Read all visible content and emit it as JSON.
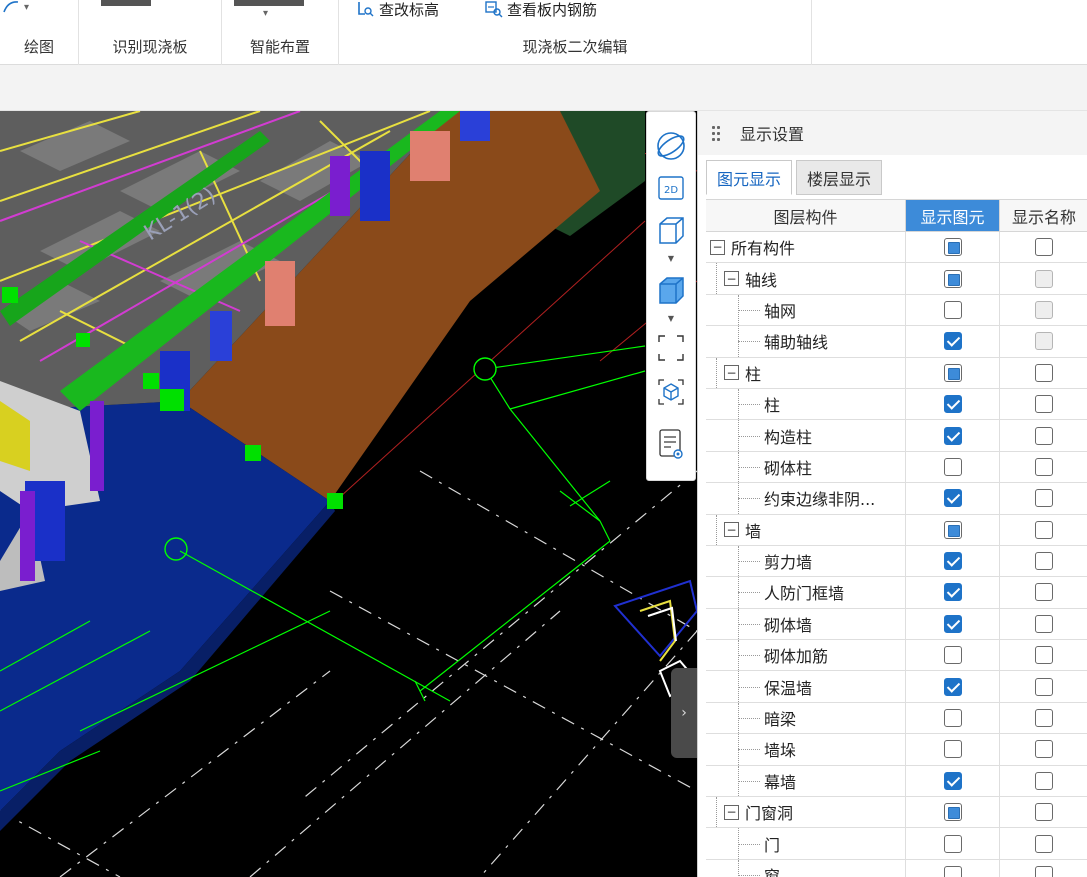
{
  "ribbon": {
    "groups": [
      {
        "label": "绘图"
      },
      {
        "label": "识别现浇板"
      },
      {
        "label": "智能布置"
      },
      {
        "label": "现浇板二次编辑"
      }
    ],
    "buttons": {
      "check_elevation": "查改标高",
      "view_rebar": "查看板内钢筋"
    }
  },
  "viewport": {
    "beam_label": "KL-1(2)"
  },
  "vtools": [
    {
      "name": "orbit-icon"
    },
    {
      "name": "2d-view-icon",
      "text": "2D"
    },
    {
      "name": "box-wireframe-icon"
    },
    {
      "name": "box-solid-icon"
    },
    {
      "name": "fit-view-icon"
    },
    {
      "name": "3d-select-icon"
    },
    {
      "name": "display-settings-icon"
    }
  ],
  "panel": {
    "title": "显示设置",
    "tabs": [
      "图元显示",
      "楼层显示"
    ],
    "columns": [
      "图层构件",
      "显示图元",
      "显示名称"
    ],
    "rows": [
      {
        "label": "所有构件",
        "level": 0,
        "expander": "−",
        "show": "partial",
        "name": "empty"
      },
      {
        "label": "轴线",
        "level": 1,
        "expander": "−",
        "show": "partial",
        "name": "disabled"
      },
      {
        "label": "轴网",
        "level": 2,
        "show": "empty",
        "name": "disabled"
      },
      {
        "label": "辅助轴线",
        "level": 2,
        "show": "checked",
        "name": "disabled"
      },
      {
        "label": "柱",
        "level": 1,
        "expander": "−",
        "show": "partial",
        "name": "empty"
      },
      {
        "label": "柱",
        "level": 2,
        "show": "checked",
        "name": "empty"
      },
      {
        "label": "构造柱",
        "level": 2,
        "show": "checked",
        "name": "empty"
      },
      {
        "label": "砌体柱",
        "level": 2,
        "show": "empty",
        "name": "empty"
      },
      {
        "label": "约束边缘非阴...",
        "level": 2,
        "show": "checked",
        "name": "empty"
      },
      {
        "label": "墙",
        "level": 1,
        "expander": "−",
        "show": "partial",
        "name": "empty"
      },
      {
        "label": "剪力墙",
        "level": 2,
        "show": "checked",
        "name": "empty"
      },
      {
        "label": "人防门框墙",
        "level": 2,
        "show": "checked",
        "name": "empty"
      },
      {
        "label": "砌体墙",
        "level": 2,
        "show": "checked",
        "name": "empty"
      },
      {
        "label": "砌体加筋",
        "level": 2,
        "show": "empty",
        "name": "empty"
      },
      {
        "label": "保温墙",
        "level": 2,
        "show": "checked",
        "name": "empty"
      },
      {
        "label": "暗梁",
        "level": 2,
        "show": "empty",
        "name": "empty"
      },
      {
        "label": "墙垛",
        "level": 2,
        "show": "empty",
        "name": "empty"
      },
      {
        "label": "幕墙",
        "level": 2,
        "show": "checked",
        "name": "empty"
      },
      {
        "label": "门窗洞",
        "level": 1,
        "expander": "−",
        "show": "partial",
        "name": "empty"
      },
      {
        "label": "门",
        "level": 2,
        "show": "empty",
        "name": "empty"
      },
      {
        "label": "窗",
        "level": 2,
        "show": "empty",
        "name": "empty"
      }
    ]
  },
  "colors": {
    "accent": "#1e73c8",
    "header_highlight": "#3d8bd9",
    "slab_blue": "#0a2a8c",
    "slab_brown": "#8a4a1a",
    "beam_green": "#19b81e",
    "grid_line": "#00ff00"
  }
}
